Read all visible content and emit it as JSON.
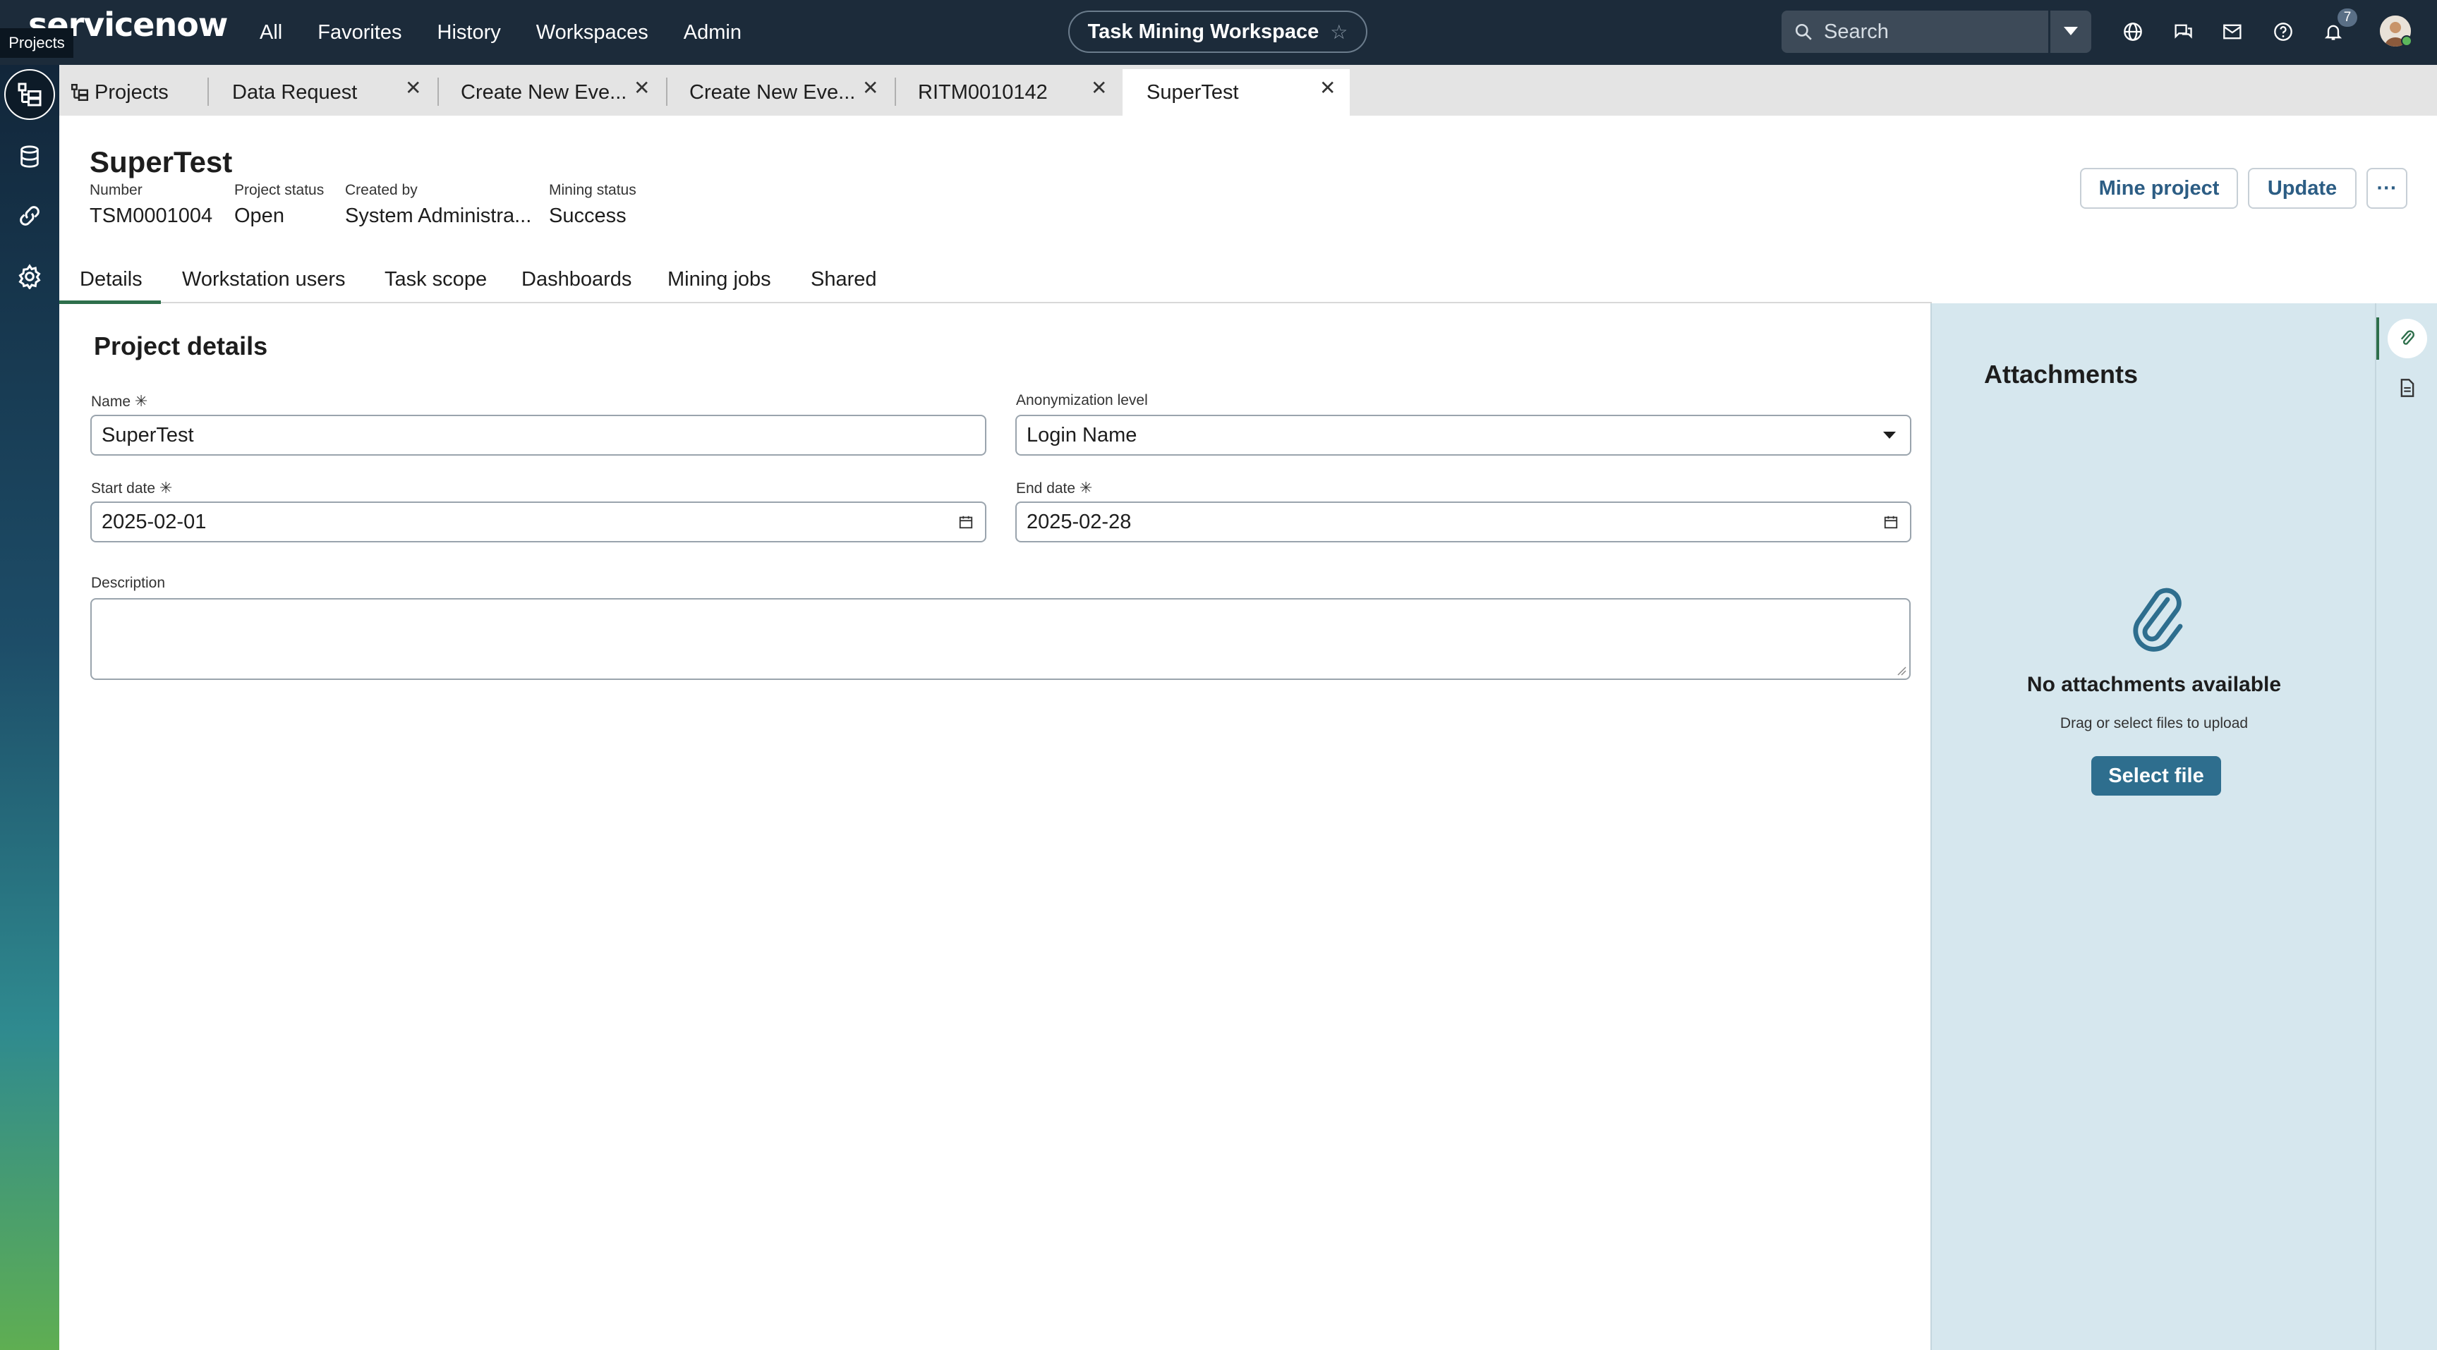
{
  "topnav": {
    "logo": "servicenow",
    "links": [
      "All",
      "Favorites",
      "History",
      "Workspaces",
      "Admin"
    ],
    "workspace": "Task Mining Workspace",
    "search_placeholder": "Search",
    "notification_count": "7"
  },
  "rail": {
    "tooltip": "Projects",
    "items": [
      "projects-icon",
      "database-icon",
      "link-icon",
      "gear-icon"
    ]
  },
  "tabs": [
    {
      "label": "Projects"
    },
    {
      "label": "Data Request"
    },
    {
      "label": "Create New Eve..."
    },
    {
      "label": "Create New Eve..."
    },
    {
      "label": "RITM0010142"
    },
    {
      "label": "SuperTest"
    }
  ],
  "record": {
    "title": "SuperTest",
    "meta": [
      {
        "label": "Number",
        "value": "TSM0001004"
      },
      {
        "label": "Project status",
        "value": "Open"
      },
      {
        "label": "Created by",
        "value": "System Administra..."
      },
      {
        "label": "Mining status",
        "value": "Success"
      }
    ],
    "actions": {
      "mine": "Mine project",
      "update": "Update",
      "more": "···"
    }
  },
  "content_tabs": [
    "Details",
    "Workstation users",
    "Task scope",
    "Dashboards",
    "Mining jobs",
    "Shared"
  ],
  "form": {
    "section_title": "Project details",
    "name_label": "Name",
    "name_value": "SuperTest",
    "anon_label": "Anonymization level",
    "anon_value": "Login Name",
    "start_label": "Start date",
    "start_value": "2025-02-01",
    "end_label": "End date",
    "end_value": "2025-02-28",
    "desc_label": "Description",
    "desc_value": "",
    "required_mark": "✳"
  },
  "attachments": {
    "title": "Attachments",
    "empty_title": "No attachments available",
    "empty_sub": "Drag or select files to upload",
    "select_label": "Select file"
  },
  "colors": {
    "nav_bg": "#1c2b3a",
    "accent_green": "#2e6f4b",
    "button_text": "#2c5d84",
    "select_file_bg": "#2e6e8e",
    "panel_bg": "#d6e7ee"
  }
}
